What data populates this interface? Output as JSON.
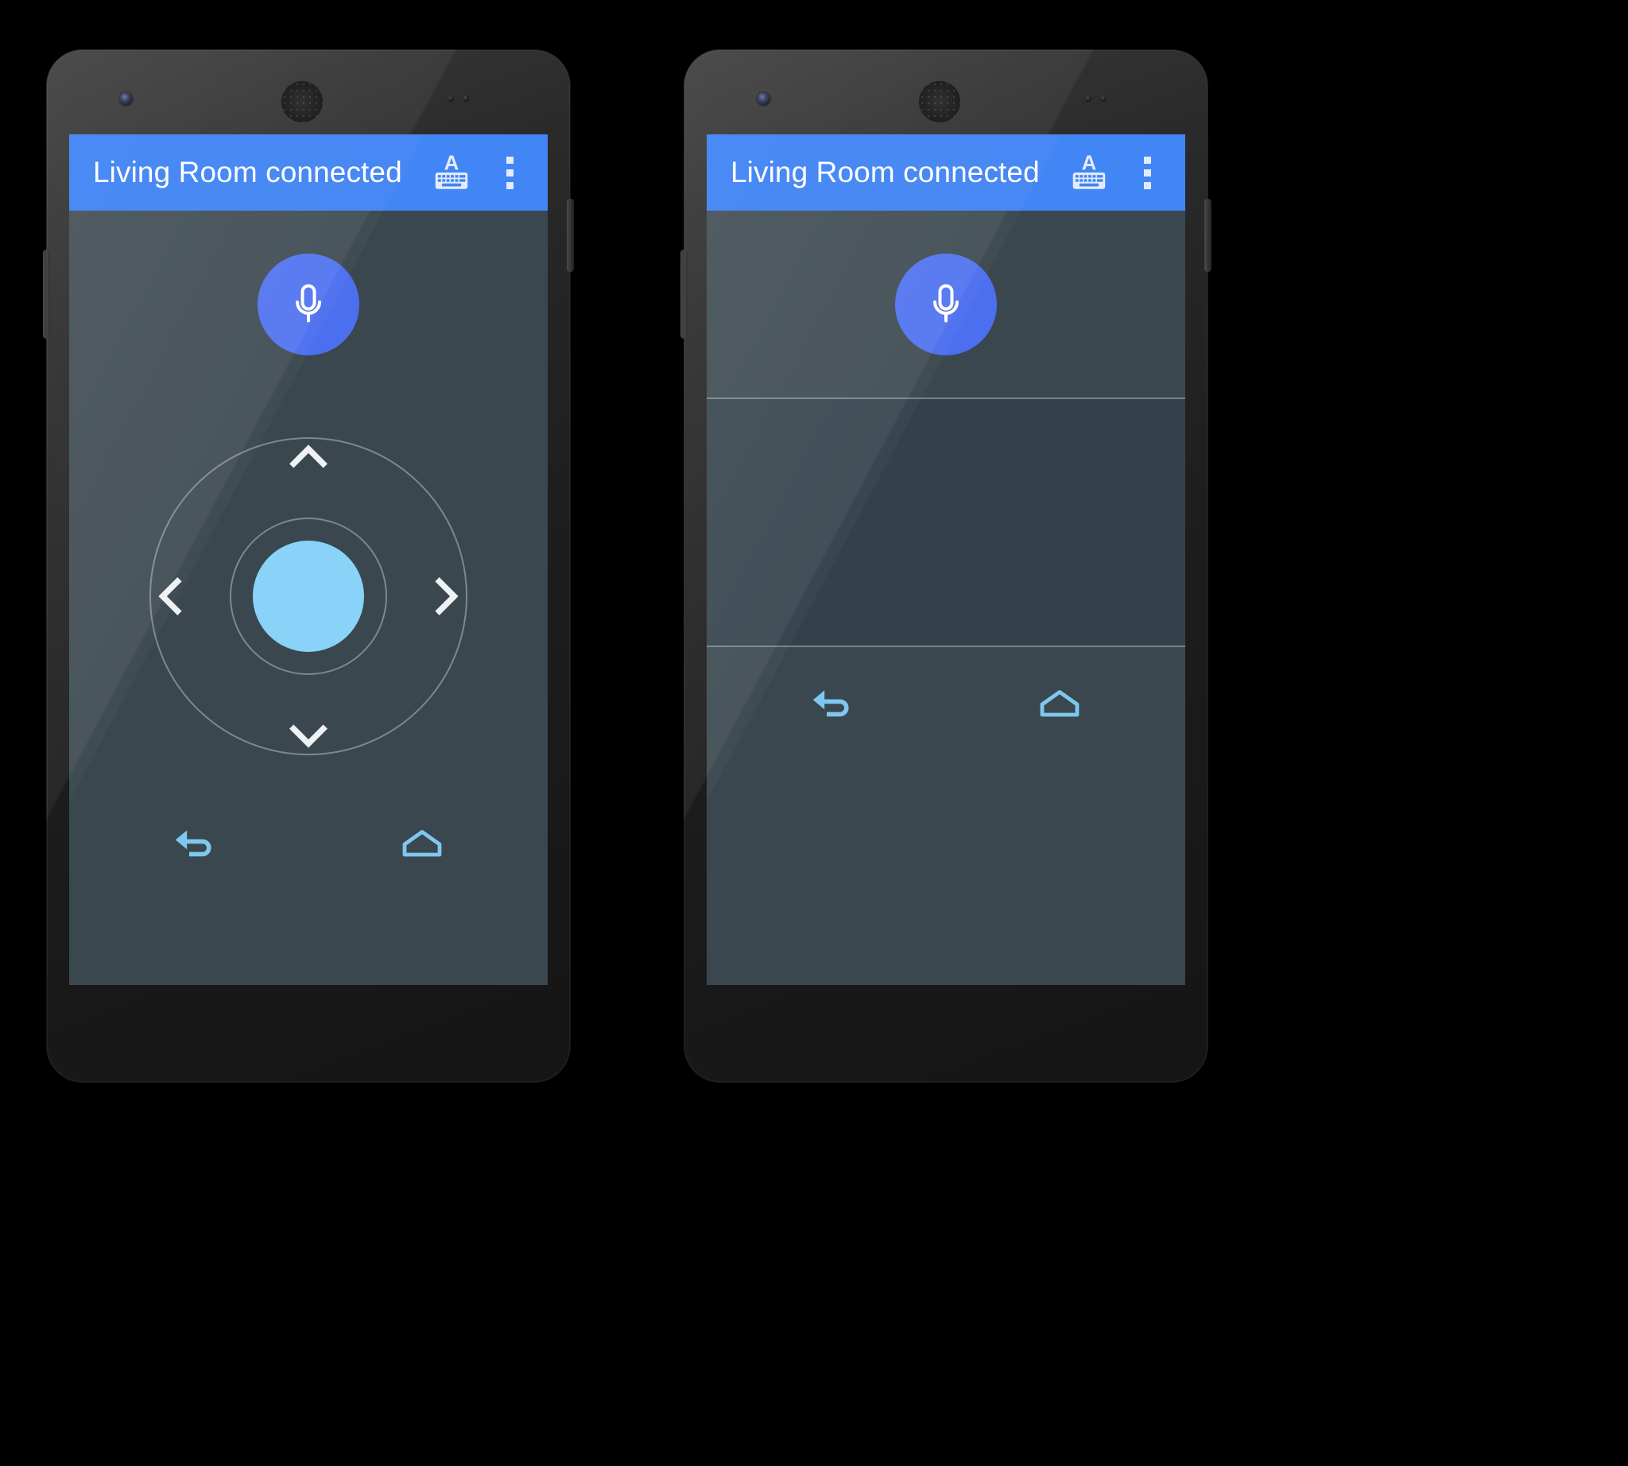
{
  "meta": {
    "background_color": "#000000",
    "device_count": 2,
    "device_name": "android-phone"
  },
  "theme": {
    "appbar_color": "#4285f4",
    "appbar_text_color": "#ffffff",
    "screen_background": "#3a474e",
    "mic_button_color": "#4c6ff0",
    "dpad_center_color": "#88d3f7",
    "dpad_ring_color": "#e1ebee",
    "nav_icon_color": "#7ec8f0",
    "divider_color": "#7d9aa2"
  },
  "phones": [
    {
      "id": "phone-left",
      "variant": "dpad-remote",
      "appbar": {
        "title": "Living Room connected",
        "actions": [
          {
            "name": "keyboard-icon",
            "label": "Keyboard",
            "glyph_letter": "A"
          },
          {
            "name": "overflow-menu-icon",
            "label": "More options",
            "dot_count": 3
          }
        ]
      },
      "content": {
        "mic_button": {
          "name": "voice-search-button",
          "label": "Voice search",
          "icon": "microphone-icon"
        },
        "dpad": {
          "name": "directional-pad",
          "center": {
            "name": "dpad-select-button",
            "label": "Select"
          },
          "up": {
            "name": "dpad-up-button",
            "label": "Up"
          },
          "down": {
            "name": "dpad-down-button",
            "label": "Down"
          },
          "left": {
            "name": "dpad-left-button",
            "label": "Left"
          },
          "right": {
            "name": "dpad-right-button",
            "label": "Right"
          }
        },
        "navbar": [
          {
            "name": "back-button",
            "label": "Back",
            "icon": "back-arrow-icon"
          },
          {
            "name": "home-button",
            "label": "Home",
            "icon": "home-icon"
          }
        ]
      }
    },
    {
      "id": "phone-right",
      "variant": "touchpad-remote",
      "appbar": {
        "title": "Living Room connected",
        "actions": [
          {
            "name": "keyboard-icon",
            "label": "Keyboard",
            "glyph_letter": "A"
          },
          {
            "name": "overflow-menu-icon",
            "label": "More options",
            "dot_count": 3
          }
        ]
      },
      "content": {
        "mic_button": {
          "name": "voice-search-button",
          "label": "Voice search",
          "icon": "microphone-icon"
        },
        "touchpad": {
          "name": "touchpad-area",
          "label": "Touchpad"
        },
        "navbar": [
          {
            "name": "back-button",
            "label": "Back",
            "icon": "back-arrow-icon"
          },
          {
            "name": "home-button",
            "label": "Home",
            "icon": "home-icon"
          }
        ]
      }
    }
  ]
}
